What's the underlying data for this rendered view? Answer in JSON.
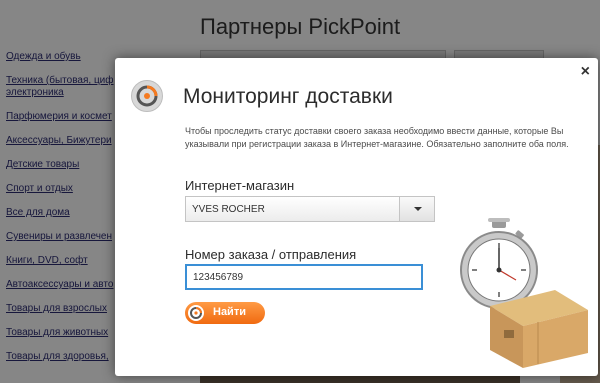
{
  "background": {
    "title": "Партнеры PickPoint",
    "categories": [
      "Одежда и обувь",
      "Техника (бытовая, циф",
      "электроника",
      "Парфюмерия и космет",
      "Аксессуары, Бижутери",
      "Детские товары",
      "Спорт и отдых",
      "Все для дома",
      "Сувениры и развлечен",
      "Книги, DVD, софт",
      "Автоаксессуары и авто",
      "Товары для взрослых",
      "Товары для животных",
      "Товары для здоровья,"
    ]
  },
  "modal": {
    "title": "Мониторинг доставки",
    "description": "Чтобы проследить статус доставки своего заказа необходимо ввести данные, которые Вы указывали при регистрации заказа в Интернет-магазине. Обязательно заполните оба поля.",
    "shop_label": "Интернет-магазин",
    "shop_value": "YVES ROCHER",
    "order_label": "Номер заказа / отправления",
    "order_value": "123456789",
    "find_label": "Найти",
    "close_glyph": "×"
  },
  "colors": {
    "accent": "#f57a20",
    "input_focus": "#3a8fd6"
  },
  "icons": [
    "pickpoint-logo-icon",
    "close-icon",
    "chevron-down-icon",
    "stopwatch-icon",
    "box-icon"
  ]
}
